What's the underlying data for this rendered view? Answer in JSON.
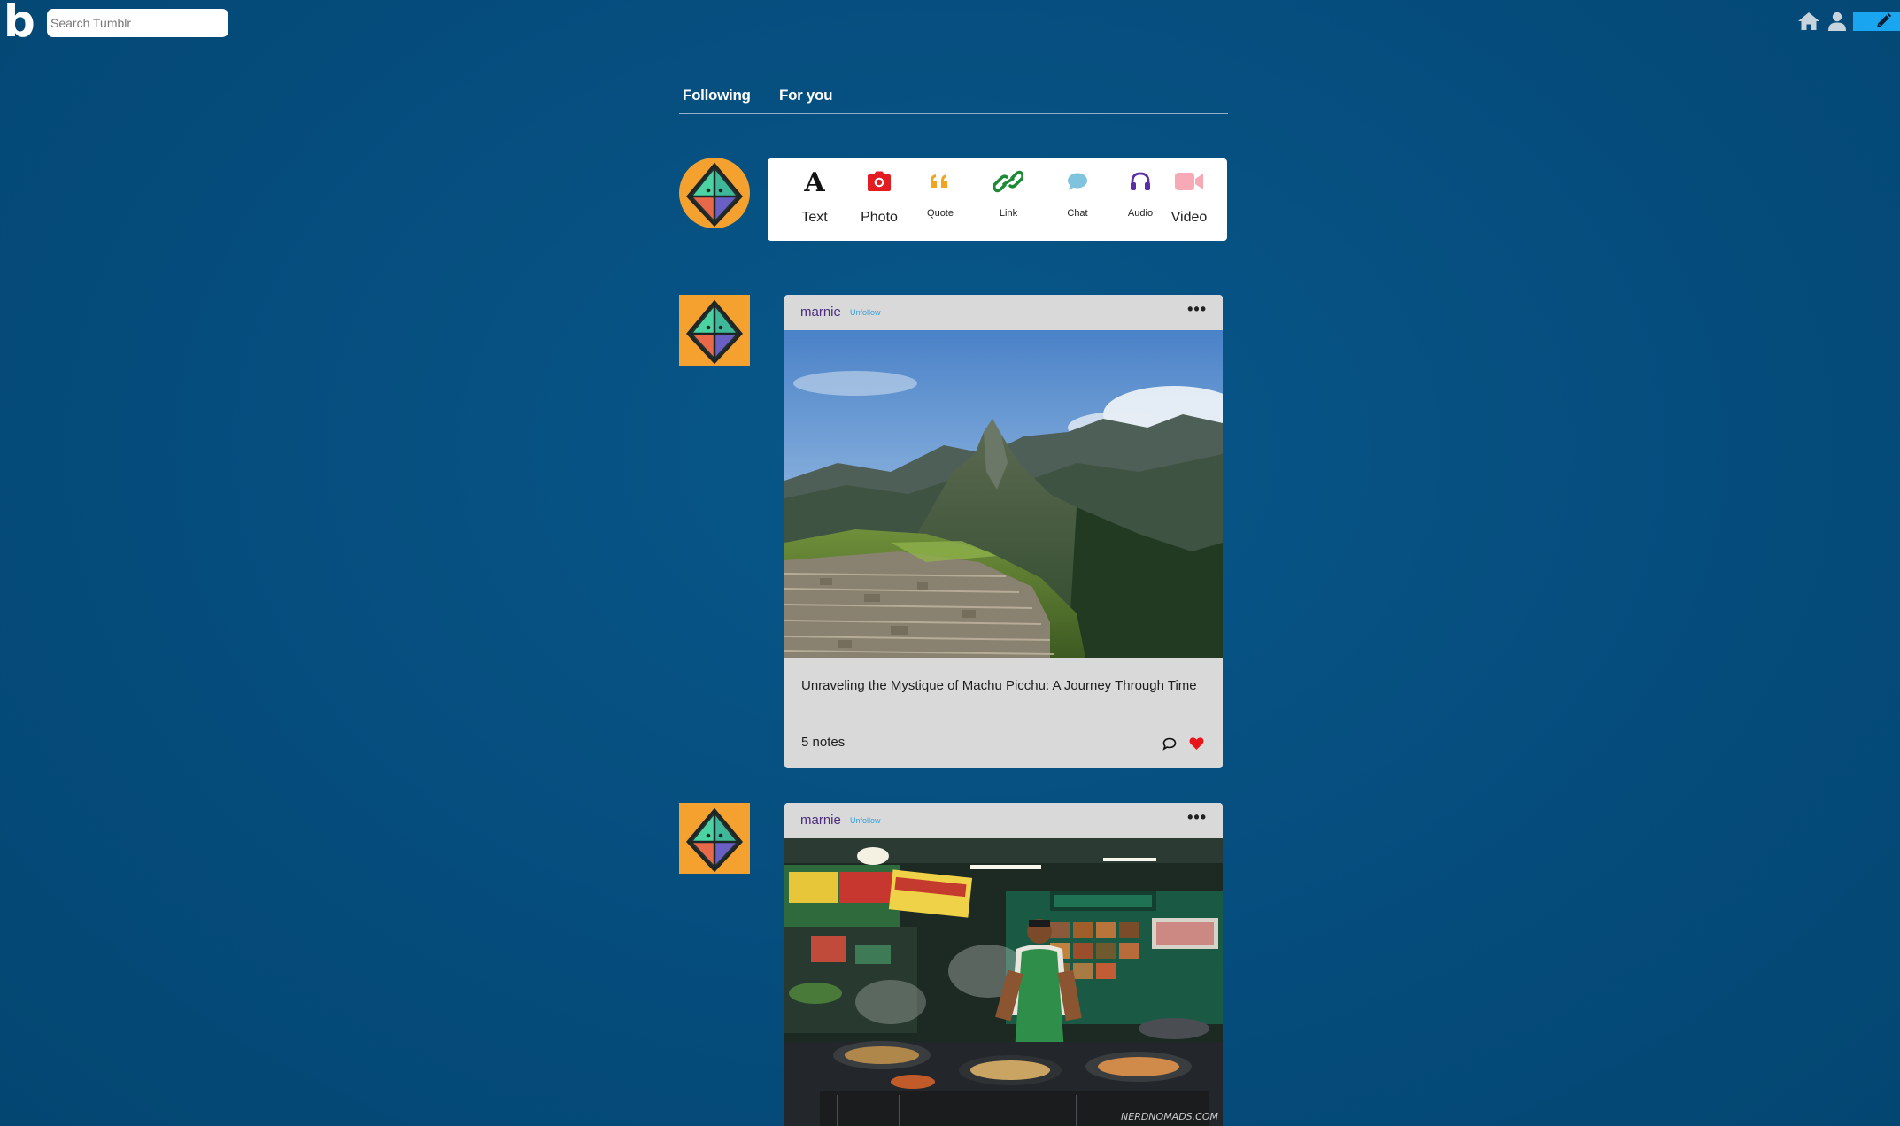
{
  "app": {
    "logo": "b",
    "search": {
      "placeholder": "Search Tumblr"
    },
    "icons": [
      "home-icon",
      "user-icon",
      "pencil-icon"
    ],
    "colors": {
      "background": "#054d7d",
      "compose": "#19a5f0"
    }
  },
  "feed": {
    "tabs": [
      {
        "label": "Following"
      },
      {
        "label": "For you"
      }
    ],
    "post_types": [
      {
        "label": "Text",
        "icon": "text-icon",
        "color": "#111111"
      },
      {
        "label": "Photo",
        "icon": "camera-icon",
        "color": "#e31b23"
      },
      {
        "label": "Quote",
        "icon": "quote-icon",
        "color": "#f2a31f"
      },
      {
        "label": "Link",
        "icon": "link-icon",
        "color": "#1f8a36"
      },
      {
        "label": "Chat",
        "icon": "chat-icon",
        "color": "#7fc3dc"
      },
      {
        "label": "Audio",
        "icon": "headphones-icon",
        "color": "#5a2ea6"
      },
      {
        "label": "Video",
        "icon": "video-icon",
        "color": "#f8a9b6"
      }
    ],
    "posts": [
      {
        "author": "marnie",
        "follow_action": "Unfollow",
        "image": "mountain-ruins-photo",
        "title": "Unraveling the Mystique of Machu Picchu: A Journey Through Time",
        "notes": "5 notes",
        "liked": true
      },
      {
        "author": "marnie",
        "follow_action": "Unfollow",
        "image": "street-food-vendor-photo",
        "watermark": "NERDNOMADS.COM"
      }
    ]
  }
}
